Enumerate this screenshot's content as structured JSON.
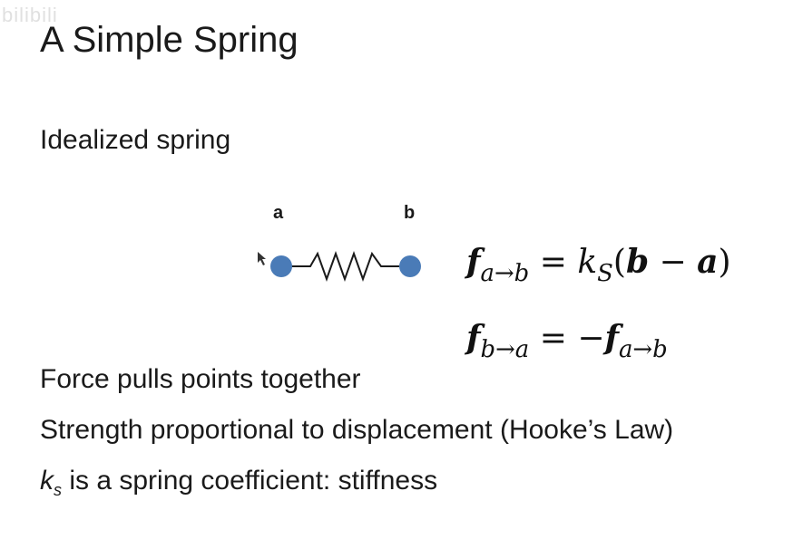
{
  "watermark": "bilibili",
  "slide": {
    "title": "A Simple Spring",
    "subhead": "Idealized spring",
    "label_a": "a",
    "label_b": "b",
    "equations": {
      "eq1": {
        "lhs_f": "f",
        "lhs_sub": "a→b",
        "eq": " = ",
        "k": "k",
        "k_sub": "S",
        "rhs": "(",
        "b": "b",
        "minus": " − ",
        "a": "a",
        "close": ")"
      },
      "eq2": {
        "lhs_f": "f",
        "lhs_sub": "b→a",
        "eq": " = ",
        "neg": "−",
        "rhs_f": "f",
        "rhs_sub": "a→b"
      }
    },
    "bullets": {
      "b1": "Force pulls points together",
      "b2": "Strength proportional to displacement (Hooke’s Law)",
      "b3_k": "k",
      "b3_sub": "s",
      "b3_rest": " is a spring coefficient: stiffness"
    }
  },
  "colors": {
    "node": "#4a7bb7",
    "spring": "#1a1a1a"
  },
  "icons": {
    "cursor": "cursor-arrow-icon"
  }
}
